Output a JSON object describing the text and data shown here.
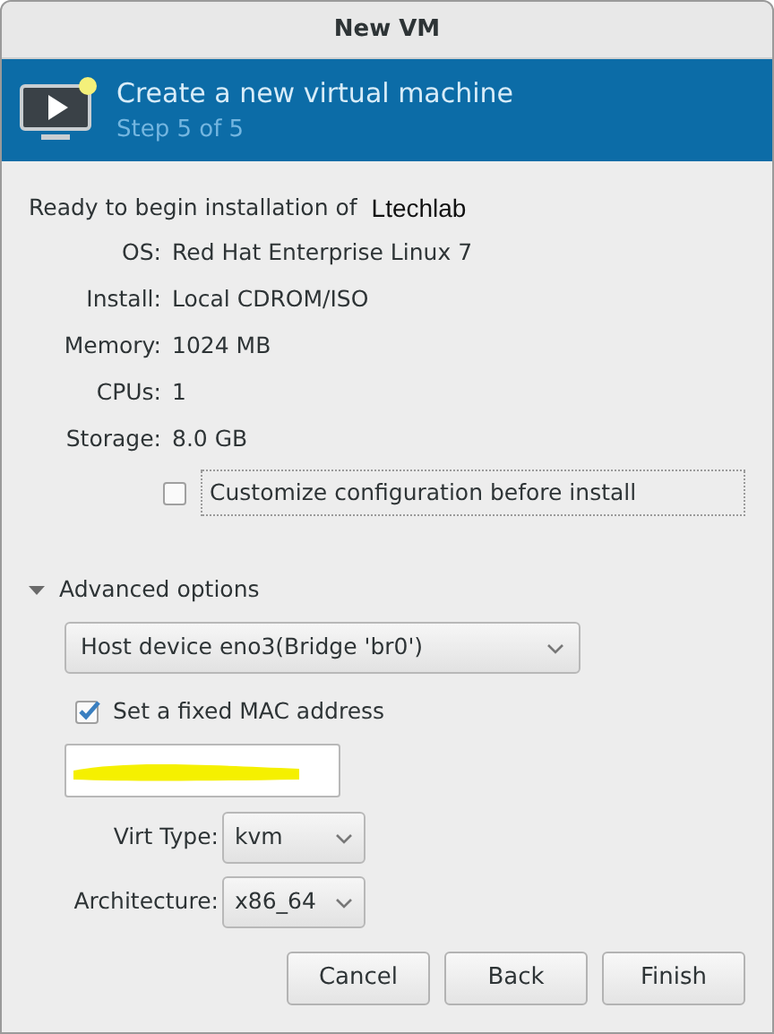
{
  "window": {
    "title": "New VM"
  },
  "header": {
    "title": "Create a new virtual machine",
    "subtitle": "Step 5 of 5"
  },
  "intro": {
    "text": "Ready to begin installation of",
    "vm_name": "Ltechlab"
  },
  "details": [
    {
      "label": "OS:",
      "value": "Red Hat Enterprise Linux 7"
    },
    {
      "label": "Install:",
      "value": "Local CDROM/ISO"
    },
    {
      "label": "Memory:",
      "value": "1024 MB"
    },
    {
      "label": "CPUs:",
      "value": "1"
    },
    {
      "label": "Storage:",
      "value": "8.0 GB"
    }
  ],
  "customize": {
    "label": "Customize configuration before install",
    "checked": false
  },
  "advanced": {
    "label": "Advanced options",
    "expanded": true,
    "network": {
      "value": "Host device eno3(Bridge 'br0')"
    },
    "fixed_mac": {
      "label": "Set a fixed MAC address",
      "checked": true
    },
    "mac_field": {
      "redacted": true
    },
    "selects": [
      {
        "label": "Virt Type:",
        "value": "kvm"
      },
      {
        "label": "Architecture:",
        "value": "x86_64"
      }
    ]
  },
  "buttons": [
    "Cancel",
    "Back",
    "Finish"
  ]
}
